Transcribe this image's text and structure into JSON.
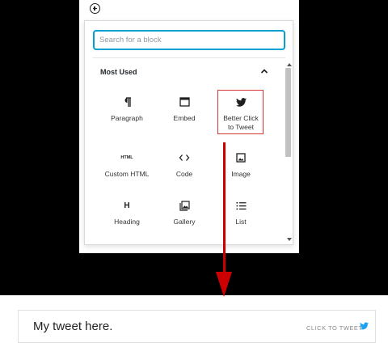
{
  "inserter": {
    "search_placeholder": "Search for a block",
    "section_title": "Most Used",
    "blocks": [
      {
        "label": "Paragraph",
        "icon": "paragraph-icon"
      },
      {
        "label": "Embed",
        "icon": "embed-icon"
      },
      {
        "label": "Better Click to Tweet",
        "icon": "twitter-icon"
      },
      {
        "label": "Custom HTML",
        "icon": "html-icon"
      },
      {
        "label": "Code",
        "icon": "code-icon"
      },
      {
        "label": "Image",
        "icon": "image-icon"
      },
      {
        "label": "Heading",
        "icon": "heading-icon"
      },
      {
        "label": "Gallery",
        "icon": "gallery-icon"
      },
      {
        "label": "List",
        "icon": "list-icon"
      }
    ],
    "html_icon_text": "HTML",
    "heading_icon_text": "H"
  },
  "tweet": {
    "text": "My tweet here.",
    "cta": "CLICK TO TWEET"
  },
  "colors": {
    "focus_border": "#00a0d2",
    "highlight_border": "#d63638",
    "arrow": "#cc0000",
    "twitter_blue": "#1da1f2"
  }
}
